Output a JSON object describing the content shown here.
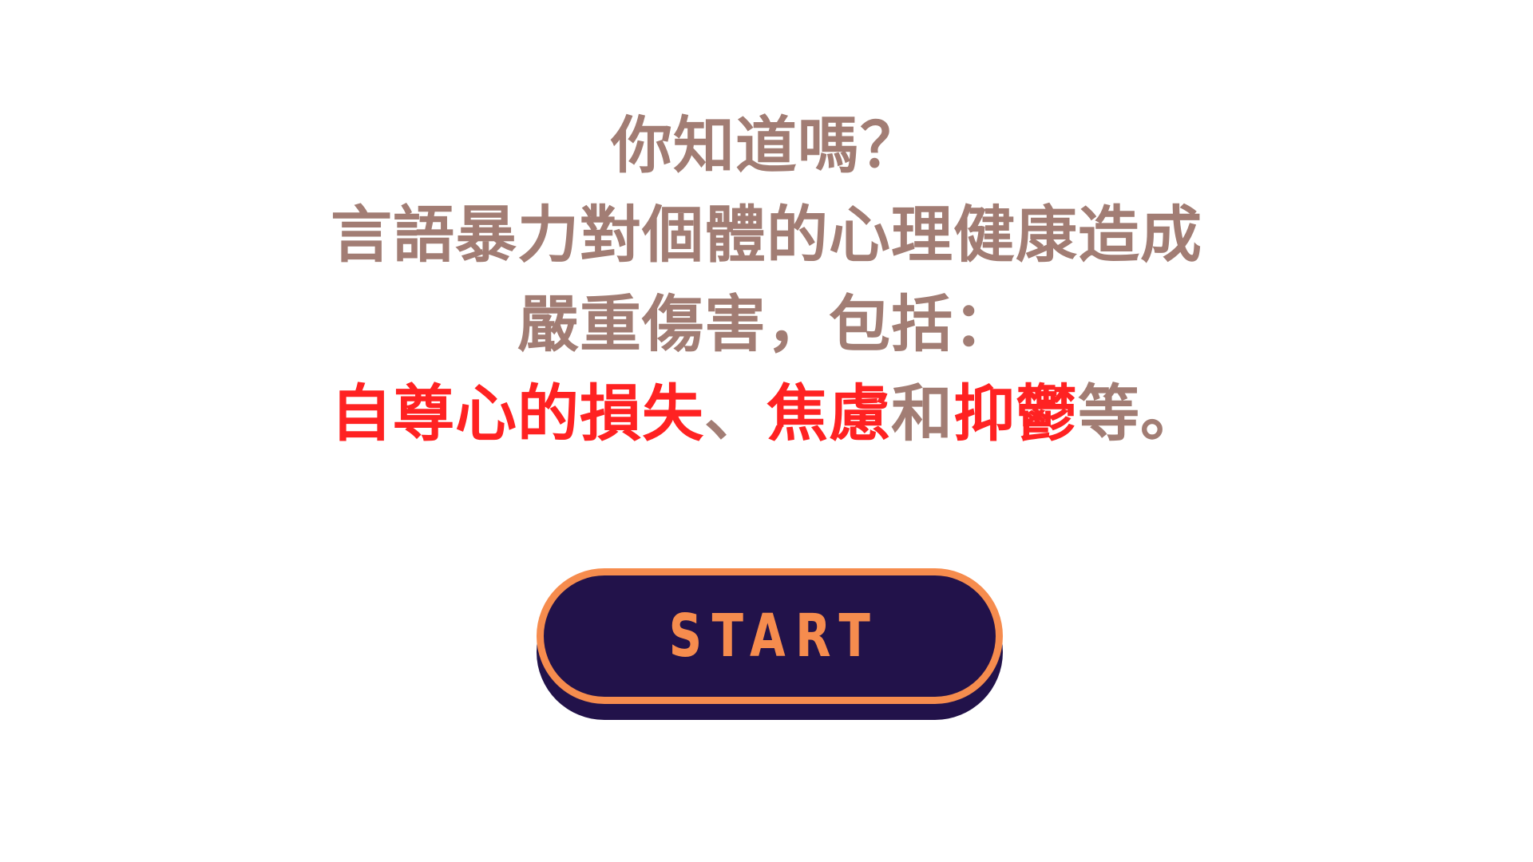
{
  "message": {
    "line1": "你知道嗎？",
    "line2": "言語暴力對個體的心理健康造成",
    "line3": "嚴重傷害，包括：",
    "line4": {
      "seg1": "自尊心的損失",
      "seg2": "、",
      "seg3": "焦慮",
      "seg4": "和",
      "seg5": "抑鬱",
      "seg6": "等。"
    }
  },
  "start_button": {
    "label": "START"
  },
  "colors": {
    "text": "#a27d74",
    "highlight": "#ff2222",
    "button_fill": "#22124a",
    "button_accent": "#f68c4e",
    "background": "#ffffff"
  }
}
